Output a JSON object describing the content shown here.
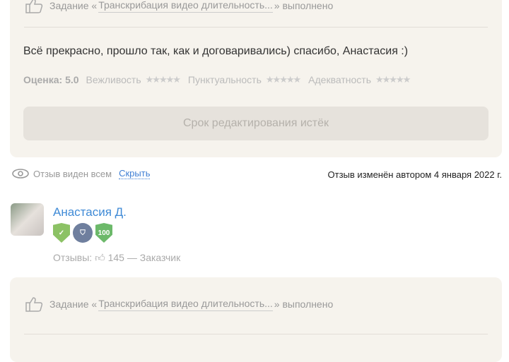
{
  "review1": {
    "task_prefix": "Задание «",
    "task_link": "Транскрибация видео длительность...",
    "task_suffix": "» выполнено",
    "text": "Всё прекрасно, прошло так, как и договаривались) спасибо, Анастасия :)",
    "score_label": "Оценка: 5.0",
    "criteria": [
      {
        "label": "Вежливость",
        "stars": 5
      },
      {
        "label": "Пунктуальность",
        "stars": 5
      },
      {
        "label": "Адекватность",
        "stars": 5
      }
    ],
    "edit_button": "Срок редактирования истёк",
    "visibility": "Отзыв виден всем",
    "hide_link": "Скрыть",
    "edited_note": "Отзыв изменён автором 4 января 2022 г."
  },
  "author": {
    "name": "Анастасия Д.",
    "badge_100": "100",
    "reviews_label": "Отзывы:",
    "reviews_count": "145",
    "role": "— Заказчик"
  },
  "review2": {
    "task_prefix": "Задание «",
    "task_link": "Транскрибация видео длительность...",
    "task_suffix": "» выполнено"
  }
}
